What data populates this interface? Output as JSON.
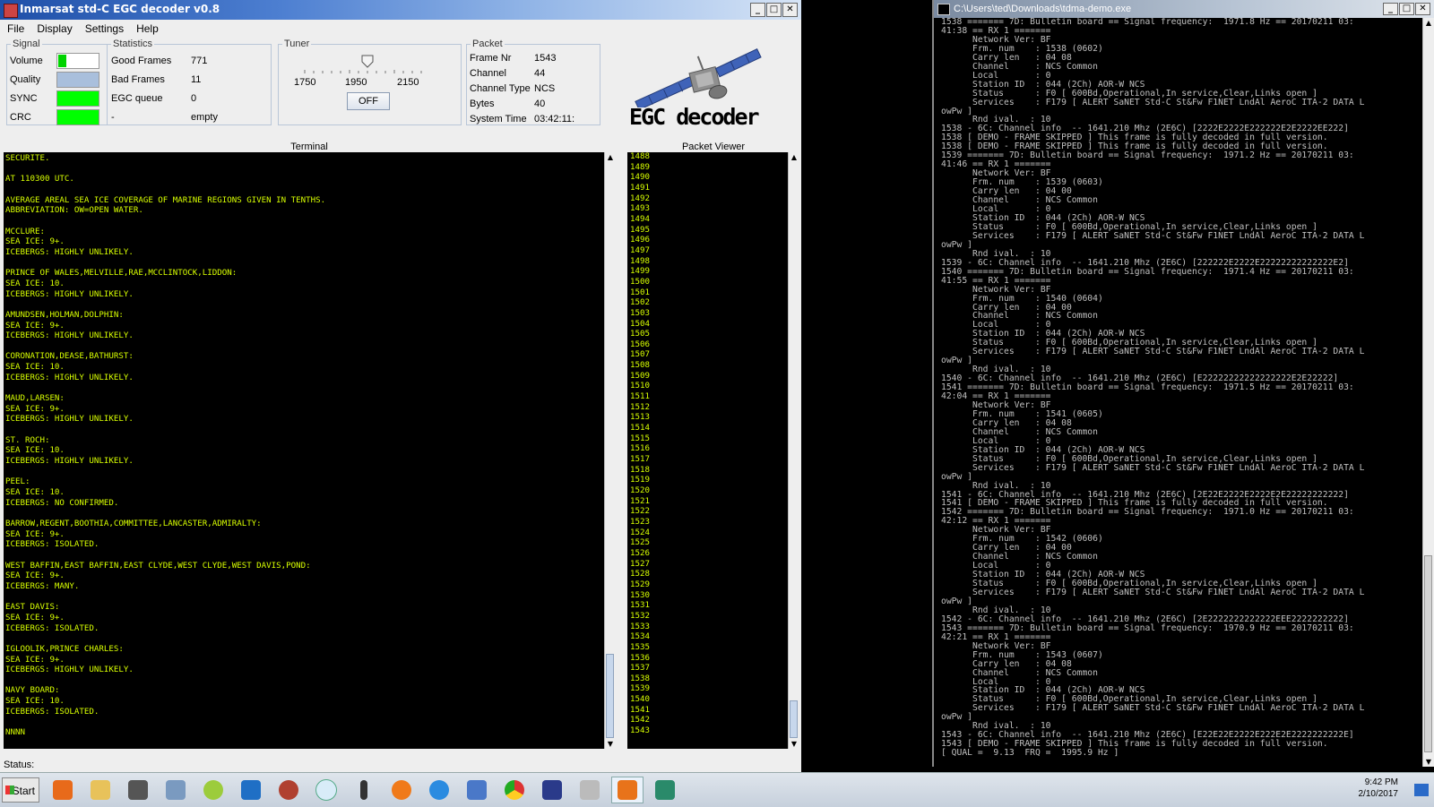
{
  "egc": {
    "title": "Inmarsat std-C EGC decoder v0.8",
    "menu": [
      "File",
      "Display",
      "Settings",
      "Help"
    ],
    "signal": {
      "legend": "Signal",
      "labels": [
        "Volume",
        "Quality",
        "SYNC",
        "CRC"
      ],
      "volume_level": 0.2
    },
    "statistics": {
      "legend": "Statistics",
      "rows": [
        {
          "label": "Good Frames",
          "value": "771"
        },
        {
          "label": "Bad Frames",
          "value": "11"
        },
        {
          "label": "EGC queue",
          "value": "0"
        },
        {
          "label": "-",
          "value": "empty"
        }
      ]
    },
    "tuner": {
      "legend": "Tuner",
      "scale": [
        "1750",
        "1950",
        "2150"
      ],
      "button": "OFF"
    },
    "packet": {
      "legend": "Packet",
      "rows": [
        {
          "label": "Frame Nr",
          "value": "1543"
        },
        {
          "label": "Channel",
          "value": "44"
        },
        {
          "label": "Channel Type",
          "value": "NCS"
        },
        {
          "label": "Bytes",
          "value": "40"
        },
        {
          "label": "System Time",
          "value": "03:42:11:"
        }
      ]
    },
    "logo_text": "EGC decoder",
    "terminal": {
      "header": "Terminal",
      "text": "SECURITE.\n\nAT 110300 UTC.\n\nAVERAGE AREAL SEA ICE COVERAGE OF MARINE REGIONS GIVEN IN TENTHS.\nABBREVIATION: OW=OPEN WATER.\n\nMCCLURE:\nSEA ICE: 9+.\nICEBERGS: HIGHLY UNLIKELY.\n\nPRINCE OF WALES,MELVILLE,RAE,MCCLINTOCK,LIDDON:\nSEA ICE: 10.\nICEBERGS: HIGHLY UNLIKELY.\n\nAMUNDSEN,HOLMAN,DOLPHIN:\nSEA ICE: 9+.\nICEBERGS: HIGHLY UNLIKELY.\n\nCORONATION,DEASE,BATHURST:\nSEA ICE: 10.\nICEBERGS: HIGHLY UNLIKELY.\n\nMAUD,LARSEN:\nSEA ICE: 9+.\nICEBERGS: HIGHLY UNLIKELY.\n\nST. ROCH:\nSEA ICE: 10.\nICEBERGS: HIGHLY UNLIKELY.\n\nPEEL:\nSEA ICE: 10.\nICEBERGS: NO CONFIRMED.\n\nBARROW,REGENT,BOOTHIA,COMMITTEE,LANCASTER,ADMIRALTY:\nSEA ICE: 9+.\nICEBERGS: ISOLATED.\n\nWEST BAFFIN,EAST BAFFIN,EAST CLYDE,WEST CLYDE,WEST DAVIS,POND:\nSEA ICE: 9+.\nICEBERGS: MANY.\n\nEAST DAVIS:\nSEA ICE: 9+.\nICEBERGS: ISOLATED.\n\nIGLOOLIK,PRINCE CHARLES:\nSEA ICE: 9+.\nICEBERGS: HIGHLY UNLIKELY.\n\nNAVY BOARD:\nSEA ICE: 10.\nICEBERGS: ISOLATED.\n\nNNNN"
    },
    "packet_viewer": {
      "header": "Packet Viewer",
      "text": "1488\n1489\n1490\n1491\n1492\n1493\n1494\n1495\n1496\n1497\n1498\n1499\n1500\n1501\n1502\n1503\n1504\n1505\n1506\n1507\n1508\n1509\n1510\n1511\n1512\n1513\n1514\n1515\n1516\n1517\n1518\n1519\n1520\n1521\n1522\n1523\n1524\n1525\n1526\n1527\n1528\n1529\n1530\n1531\n1532\n1533\n1534\n1535\n1536\n1537\n1538\n1539\n1540\n1541\n1542\n1543"
    },
    "status": "Status:"
  },
  "console": {
    "title": "C:\\Users\\ted\\Downloads\\tdma-demo.exe",
    "text": "1538 ======= 7D: Bulletin board == Signal frequency:  1971.8 Hz == 20170211 03:\n41:38 == RX 1 =======\n      Network Ver: BF\n      Frm. num    : 1538 (0602)\n      Carry len   : 04 08\n      Channel     : NCS Common\n      Local       : 0\n      Station ID  : 044 (2Ch) AOR-W NCS\n      Status      : F0 [ 600Bd,Operational,In service,Clear,Links open ]\n      Services    : F179 [ ALERT SaNET Std-C St&Fw F1NET LndAl AeroC ITA-2 DATA L\nowPw ]\n      Rnd ival.  : 10\n1538 - 6C: Channel info  -- 1641.210 Mhz (2E6C) [2222E2222E222222E2E2222EE222]\n1538 [ DEMO - FRAME SKIPPED ] This frame is fully decoded in full version.\n1538 [ DEMO - FRAME SKIPPED ] This frame is fully decoded in full version.\n1539 ======= 7D: Bulletin board == Signal frequency:  1971.2 Hz == 20170211 03:\n41:46 == RX 1 =======\n      Network Ver: BF\n      Frm. num    : 1539 (0603)\n      Carry len   : 04 00\n      Channel     : NCS Common\n      Local       : 0\n      Station ID  : 044 (2Ch) AOR-W NCS\n      Status      : F0 [ 600Bd,Operational,In service,Clear,Links open ]\n      Services    : F179 [ ALERT SaNET Std-C St&Fw F1NET LndAl AeroC ITA-2 DATA L\nowPw ]\n      Rnd ival.  : 10\n1539 - 6C: Channel info  -- 1641.210 Mhz (2E6C) [222222E2222E22222222222222E2]\n1540 ======= 7D: Bulletin board == Signal frequency:  1971.4 Hz == 20170211 03:\n41:55 == RX 1 =======\n      Network Ver: BF\n      Frm. num    : 1540 (0604)\n      Carry len   : 04 00\n      Channel     : NCS Common\n      Local       : 0\n      Station ID  : 044 (2Ch) AOR-W NCS\n      Status      : F0 [ 600Bd,Operational,In service,Clear,Links open ]\n      Services    : F179 [ ALERT SaNET Std-C St&Fw F1NET LndAl AeroC ITA-2 DATA L\nowPw ]\n      Rnd ival.  : 10\n1540 - 6C: Channel info  -- 1641.210 Mhz (2E6C) [E22222222222222222E2E22222]\n1541 ======= 7D: Bulletin board == Signal frequency:  1971.5 Hz == 20170211 03:\n42:04 == RX 1 =======\n      Network Ver: BF\n      Frm. num    : 1541 (0605)\n      Carry len   : 04 08\n      Channel     : NCS Common\n      Local       : 0\n      Station ID  : 044 (2Ch) AOR-W NCS\n      Status      : F0 [ 600Bd,Operational,In service,Clear,Links open ]\n      Services    : F179 [ ALERT SaNET Std-C St&Fw F1NET LndAl AeroC ITA-2 DATA L\nowPw ]\n      Rnd ival.  : 10\n1541 - 6C: Channel info  -- 1641.210 Mhz (2E6C) [2E22E2222E2222E2E22222222222]\n1541 [ DEMO - FRAME SKIPPED ] This frame is fully decoded in full version.\n1542 ======= 7D: Bulletin board == Signal frequency:  1971.0 Hz == 20170211 03:\n42:12 == RX 1 =======\n      Network Ver: BF\n      Frm. num    : 1542 (0606)\n      Carry len   : 04 00\n      Channel     : NCS Common\n      Local       : 0\n      Station ID  : 044 (2Ch) AOR-W NCS\n      Status      : F0 [ 600Bd,Operational,In service,Clear,Links open ]\n      Services    : F179 [ ALERT SaNET Std-C St&Fw F1NET LndAl AeroC ITA-2 DATA L\nowPw ]\n      Rnd ival.  : 10\n1542 - 6C: Channel info  -- 1641.210 Mhz (2E6C) [2E2222222222222EEE2222222222]\n1543 ======= 7D: Bulletin board == Signal frequency:  1970.9 Hz == 20170211 03:\n42:21 == RX 1 =======\n      Network Ver: BF\n      Frm. num    : 1543 (0607)\n      Carry len   : 04 08\n      Channel     : NCS Common\n      Local       : 0\n      Station ID  : 044 (2Ch) AOR-W NCS\n      Status      : F0 [ 600Bd,Operational,In service,Clear,Links open ]\n      Services    : F179 [ ALERT SaNET Std-C St&Fw F1NET LndAl AeroC ITA-2 DATA L\nowPw ]\n      Rnd ival.  : 10\n1543 - 6C: Channel info  -- 1641.210 Mhz (2E6C) [E22E22E2222E222E2E2222222222E]\n1543 [ DEMO - FRAME SKIPPED ] This frame is fully decoded in full version.\n[ QUAL =  9.13  FRQ =  1995.9 Hz ]"
  },
  "taskbar": {
    "start": "Start",
    "time": "9:42 PM",
    "date": "2/10/2017"
  },
  "colors": {
    "terminal_text": "#d8ff00",
    "console_text": "#c0c0c0",
    "indicator_green": "#00ff00"
  }
}
